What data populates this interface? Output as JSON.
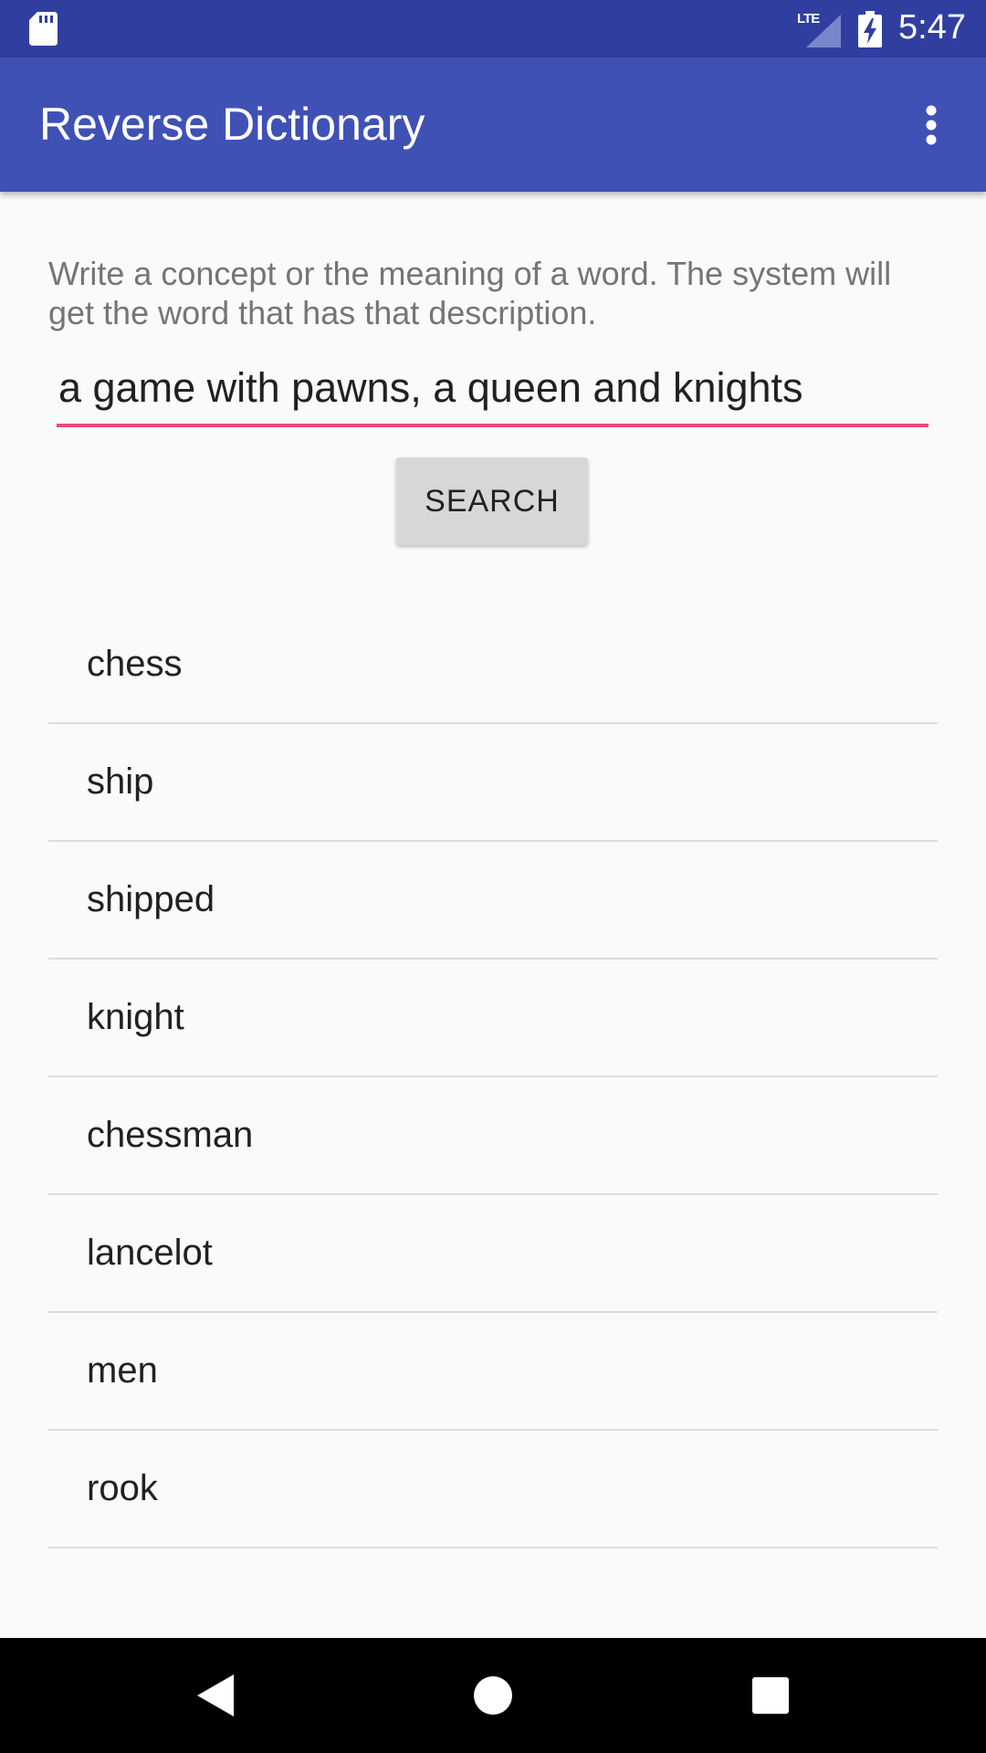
{
  "status_bar": {
    "network_label": "LTE",
    "time": "5:47"
  },
  "app_bar": {
    "title": "Reverse Dictionary",
    "menu_icon": "more-vert-icon"
  },
  "instructions": "Write a concept or the meaning of a word. The system will get the word that has that description.",
  "search": {
    "query": "a game with pawns, a queen and knights",
    "button_label": "SEARCH"
  },
  "results": [
    "chess",
    "ship",
    "shipped",
    "knight",
    "chessman",
    "lancelot",
    "men",
    "rook"
  ],
  "navigation": {
    "back_icon": "back-triangle-icon",
    "home_icon": "home-circle-icon",
    "recents_icon": "recents-square-icon"
  },
  "colors": {
    "status_bar": "#303f9f",
    "app_bar": "#3f51b5",
    "accent": "#e8487e",
    "background": "#fafafa",
    "button": "#d6d7d7"
  }
}
